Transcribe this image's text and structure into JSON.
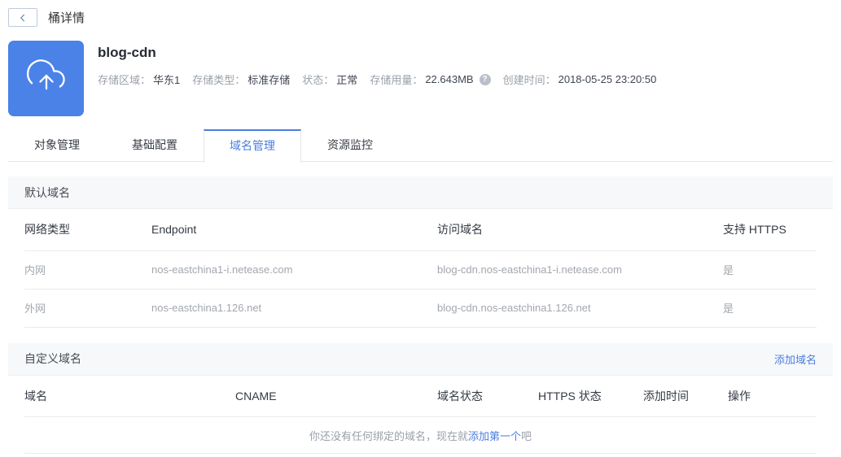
{
  "colors": {
    "accent": "#4a7de0",
    "bucket_icon_bg": "#4a82e8",
    "section_bg": "#f7f8fa"
  },
  "icons": {
    "help": "?"
  },
  "header": {
    "page_title": "桶详情",
    "bucket_name": "blog-cdn",
    "fields": [
      {
        "label": "存储区域：",
        "value": "华东1"
      },
      {
        "label": "存储类型：",
        "value": "标准存储"
      },
      {
        "label": "状态：",
        "value": "正常"
      },
      {
        "label": "存储用量：",
        "value": "22.643MB"
      },
      {
        "label": "创建时间：",
        "value": "2018-05-25 23:20:50"
      }
    ]
  },
  "tabs": [
    {
      "label": "对象管理",
      "active": false
    },
    {
      "label": "基础配置",
      "active": false
    },
    {
      "label": "域名管理",
      "active": true
    },
    {
      "label": "资源监控",
      "active": false
    }
  ],
  "default_domains": {
    "section_title": "默认域名",
    "columns": [
      "网络类型",
      "Endpoint",
      "访问域名",
      "支持 HTTPS"
    ],
    "rows": [
      [
        "内网",
        "nos-eastchina1-i.netease.com",
        "blog-cdn.nos-eastchina1-i.netease.com",
        "是"
      ],
      [
        "外网",
        "nos-eastchina1.126.net",
        "blog-cdn.nos-eastchina1.126.net",
        "是"
      ]
    ]
  },
  "custom_domains": {
    "section_title": "自定义域名",
    "add_link": "添加域名",
    "columns": [
      "域名",
      "CNAME",
      "域名状态",
      "HTTPS 状态",
      "添加时间",
      "操作"
    ],
    "empty": {
      "prefix": "你还没有任何绑定的域名，现在就",
      "link": "添加第一个",
      "suffix": "吧"
    }
  }
}
